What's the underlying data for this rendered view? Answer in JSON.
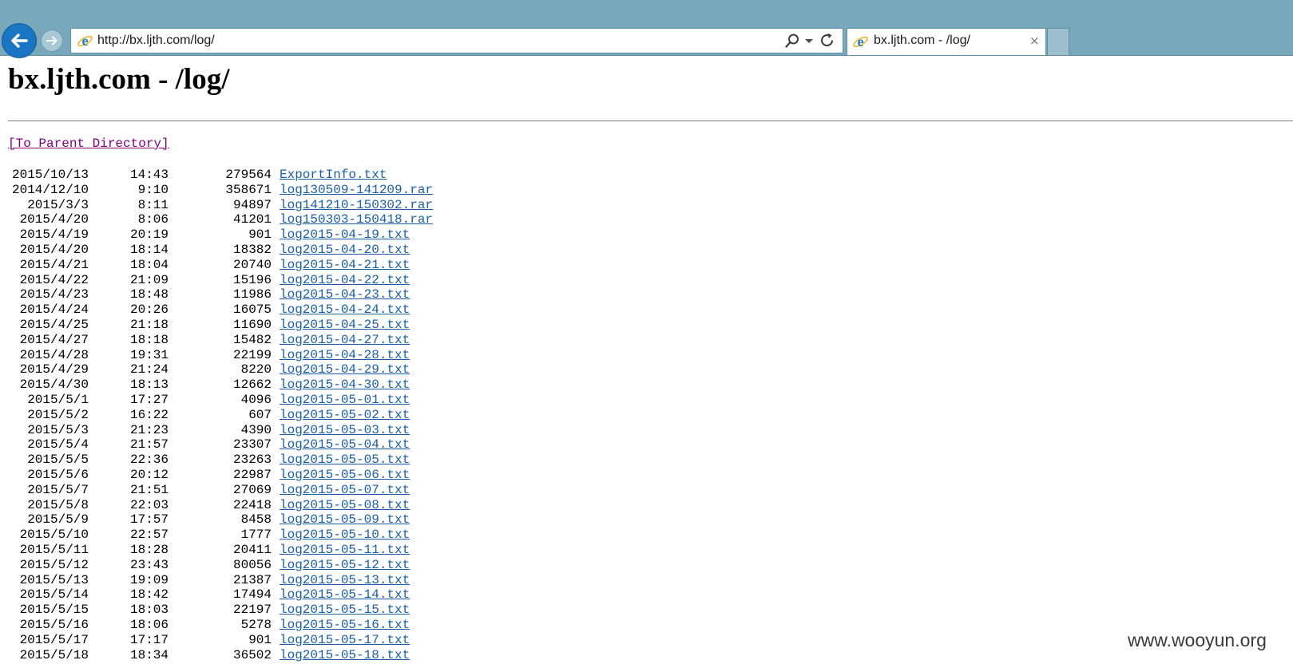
{
  "browser": {
    "url": "http://bx.ljth.com/log/",
    "tab_title": "bx.ljth.com - /log/",
    "tab_close": "×"
  },
  "page": {
    "title": "bx.ljth.com - /log/",
    "parent_link": "[To Parent Directory]",
    "files": [
      {
        "date": "2015/10/13",
        "time": "14:43",
        "size": "279564",
        "name": "ExportInfo.txt"
      },
      {
        "date": "2014/12/10",
        "time": "9:10",
        "size": "358671",
        "name": "log130509-141209.rar"
      },
      {
        "date": "2015/3/3",
        "time": "8:11",
        "size": "94897",
        "name": "log141210-150302.rar"
      },
      {
        "date": "2015/4/20",
        "time": "8:06",
        "size": "41201",
        "name": "log150303-150418.rar"
      },
      {
        "date": "2015/4/19",
        "time": "20:19",
        "size": "901",
        "name": "log2015-04-19.txt"
      },
      {
        "date": "2015/4/20",
        "time": "18:14",
        "size": "18382",
        "name": "log2015-04-20.txt"
      },
      {
        "date": "2015/4/21",
        "time": "18:04",
        "size": "20740",
        "name": "log2015-04-21.txt"
      },
      {
        "date": "2015/4/22",
        "time": "21:09",
        "size": "15196",
        "name": "log2015-04-22.txt"
      },
      {
        "date": "2015/4/23",
        "time": "18:48",
        "size": "11986",
        "name": "log2015-04-23.txt"
      },
      {
        "date": "2015/4/24",
        "time": "20:26",
        "size": "16075",
        "name": "log2015-04-24.txt"
      },
      {
        "date": "2015/4/25",
        "time": "21:18",
        "size": "11690",
        "name": "log2015-04-25.txt"
      },
      {
        "date": "2015/4/27",
        "time": "18:18",
        "size": "15482",
        "name": "log2015-04-27.txt"
      },
      {
        "date": "2015/4/28",
        "time": "19:31",
        "size": "22199",
        "name": "log2015-04-28.txt"
      },
      {
        "date": "2015/4/29",
        "time": "21:24",
        "size": "8220",
        "name": "log2015-04-29.txt"
      },
      {
        "date": "2015/4/30",
        "time": "18:13",
        "size": "12662",
        "name": "log2015-04-30.txt"
      },
      {
        "date": "2015/5/1",
        "time": "17:27",
        "size": "4096",
        "name": "log2015-05-01.txt"
      },
      {
        "date": "2015/5/2",
        "time": "16:22",
        "size": "607",
        "name": "log2015-05-02.txt"
      },
      {
        "date": "2015/5/3",
        "time": "21:23",
        "size": "4390",
        "name": "log2015-05-03.txt"
      },
      {
        "date": "2015/5/4",
        "time": "21:57",
        "size": "23307",
        "name": "log2015-05-04.txt"
      },
      {
        "date": "2015/5/5",
        "time": "22:36",
        "size": "23263",
        "name": "log2015-05-05.txt"
      },
      {
        "date": "2015/5/6",
        "time": "20:12",
        "size": "22987",
        "name": "log2015-05-06.txt"
      },
      {
        "date": "2015/5/7",
        "time": "21:51",
        "size": "27069",
        "name": "log2015-05-07.txt"
      },
      {
        "date": "2015/5/8",
        "time": "22:03",
        "size": "22418",
        "name": "log2015-05-08.txt"
      },
      {
        "date": "2015/5/9",
        "time": "17:57",
        "size": "8458",
        "name": "log2015-05-09.txt"
      },
      {
        "date": "2015/5/10",
        "time": "22:57",
        "size": "1777",
        "name": "log2015-05-10.txt"
      },
      {
        "date": "2015/5/11",
        "time": "18:28",
        "size": "20411",
        "name": "log2015-05-11.txt"
      },
      {
        "date": "2015/5/12",
        "time": "23:43",
        "size": "80056",
        "name": "log2015-05-12.txt"
      },
      {
        "date": "2015/5/13",
        "time": "19:09",
        "size": "21387",
        "name": "log2015-05-13.txt"
      },
      {
        "date": "2015/5/14",
        "time": "18:42",
        "size": "17494",
        "name": "log2015-05-14.txt"
      },
      {
        "date": "2015/5/15",
        "time": "18:03",
        "size": "22197",
        "name": "log2015-05-15.txt"
      },
      {
        "date": "2015/5/16",
        "time": "18:06",
        "size": "5278",
        "name": "log2015-05-16.txt"
      },
      {
        "date": "2015/5/17",
        "time": "17:17",
        "size": "901",
        "name": "log2015-05-17.txt"
      },
      {
        "date": "2015/5/18",
        "time": "18:34",
        "size": "36502",
        "name": "log2015-05-18.txt"
      }
    ]
  },
  "watermark": "www.wooyun.org",
  "icons": {
    "back": "back-arrow-icon",
    "forward": "forward-arrow-icon",
    "site": "internet-explorer-icon",
    "search": "search-icon",
    "dropdown": "dropdown-arrow-icon",
    "refresh": "refresh-icon",
    "close": "close-icon"
  },
  "colors": {
    "chrome": "#78a8bc",
    "back_button": "#1a75c2",
    "link": "#1a5fa6",
    "visited_link": "#800080"
  }
}
